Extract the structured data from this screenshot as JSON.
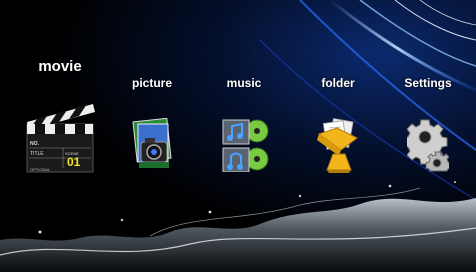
{
  "menu": {
    "items": [
      {
        "label": "movie",
        "icon": "clapperboard-icon",
        "selected": true
      },
      {
        "label": "picture",
        "icon": "camera-photo-icon",
        "selected": false
      },
      {
        "label": "music",
        "icon": "music-notes-icon",
        "selected": false
      },
      {
        "label": "folder",
        "icon": "folder-documents-icon",
        "selected": false
      },
      {
        "label": "Settings",
        "icon": "gear-icon",
        "selected": false
      }
    ],
    "clapperboard": {
      "no_label": "NO.",
      "title_label": "TITLE",
      "scene_label": "SCENE",
      "number": "01",
      "optional_label": "OPTIONAL"
    }
  },
  "colors": {
    "background": "#000000",
    "accent_blue": "#1e64ff",
    "label": "#ffffff",
    "clapper_number": "#f5e51a"
  }
}
